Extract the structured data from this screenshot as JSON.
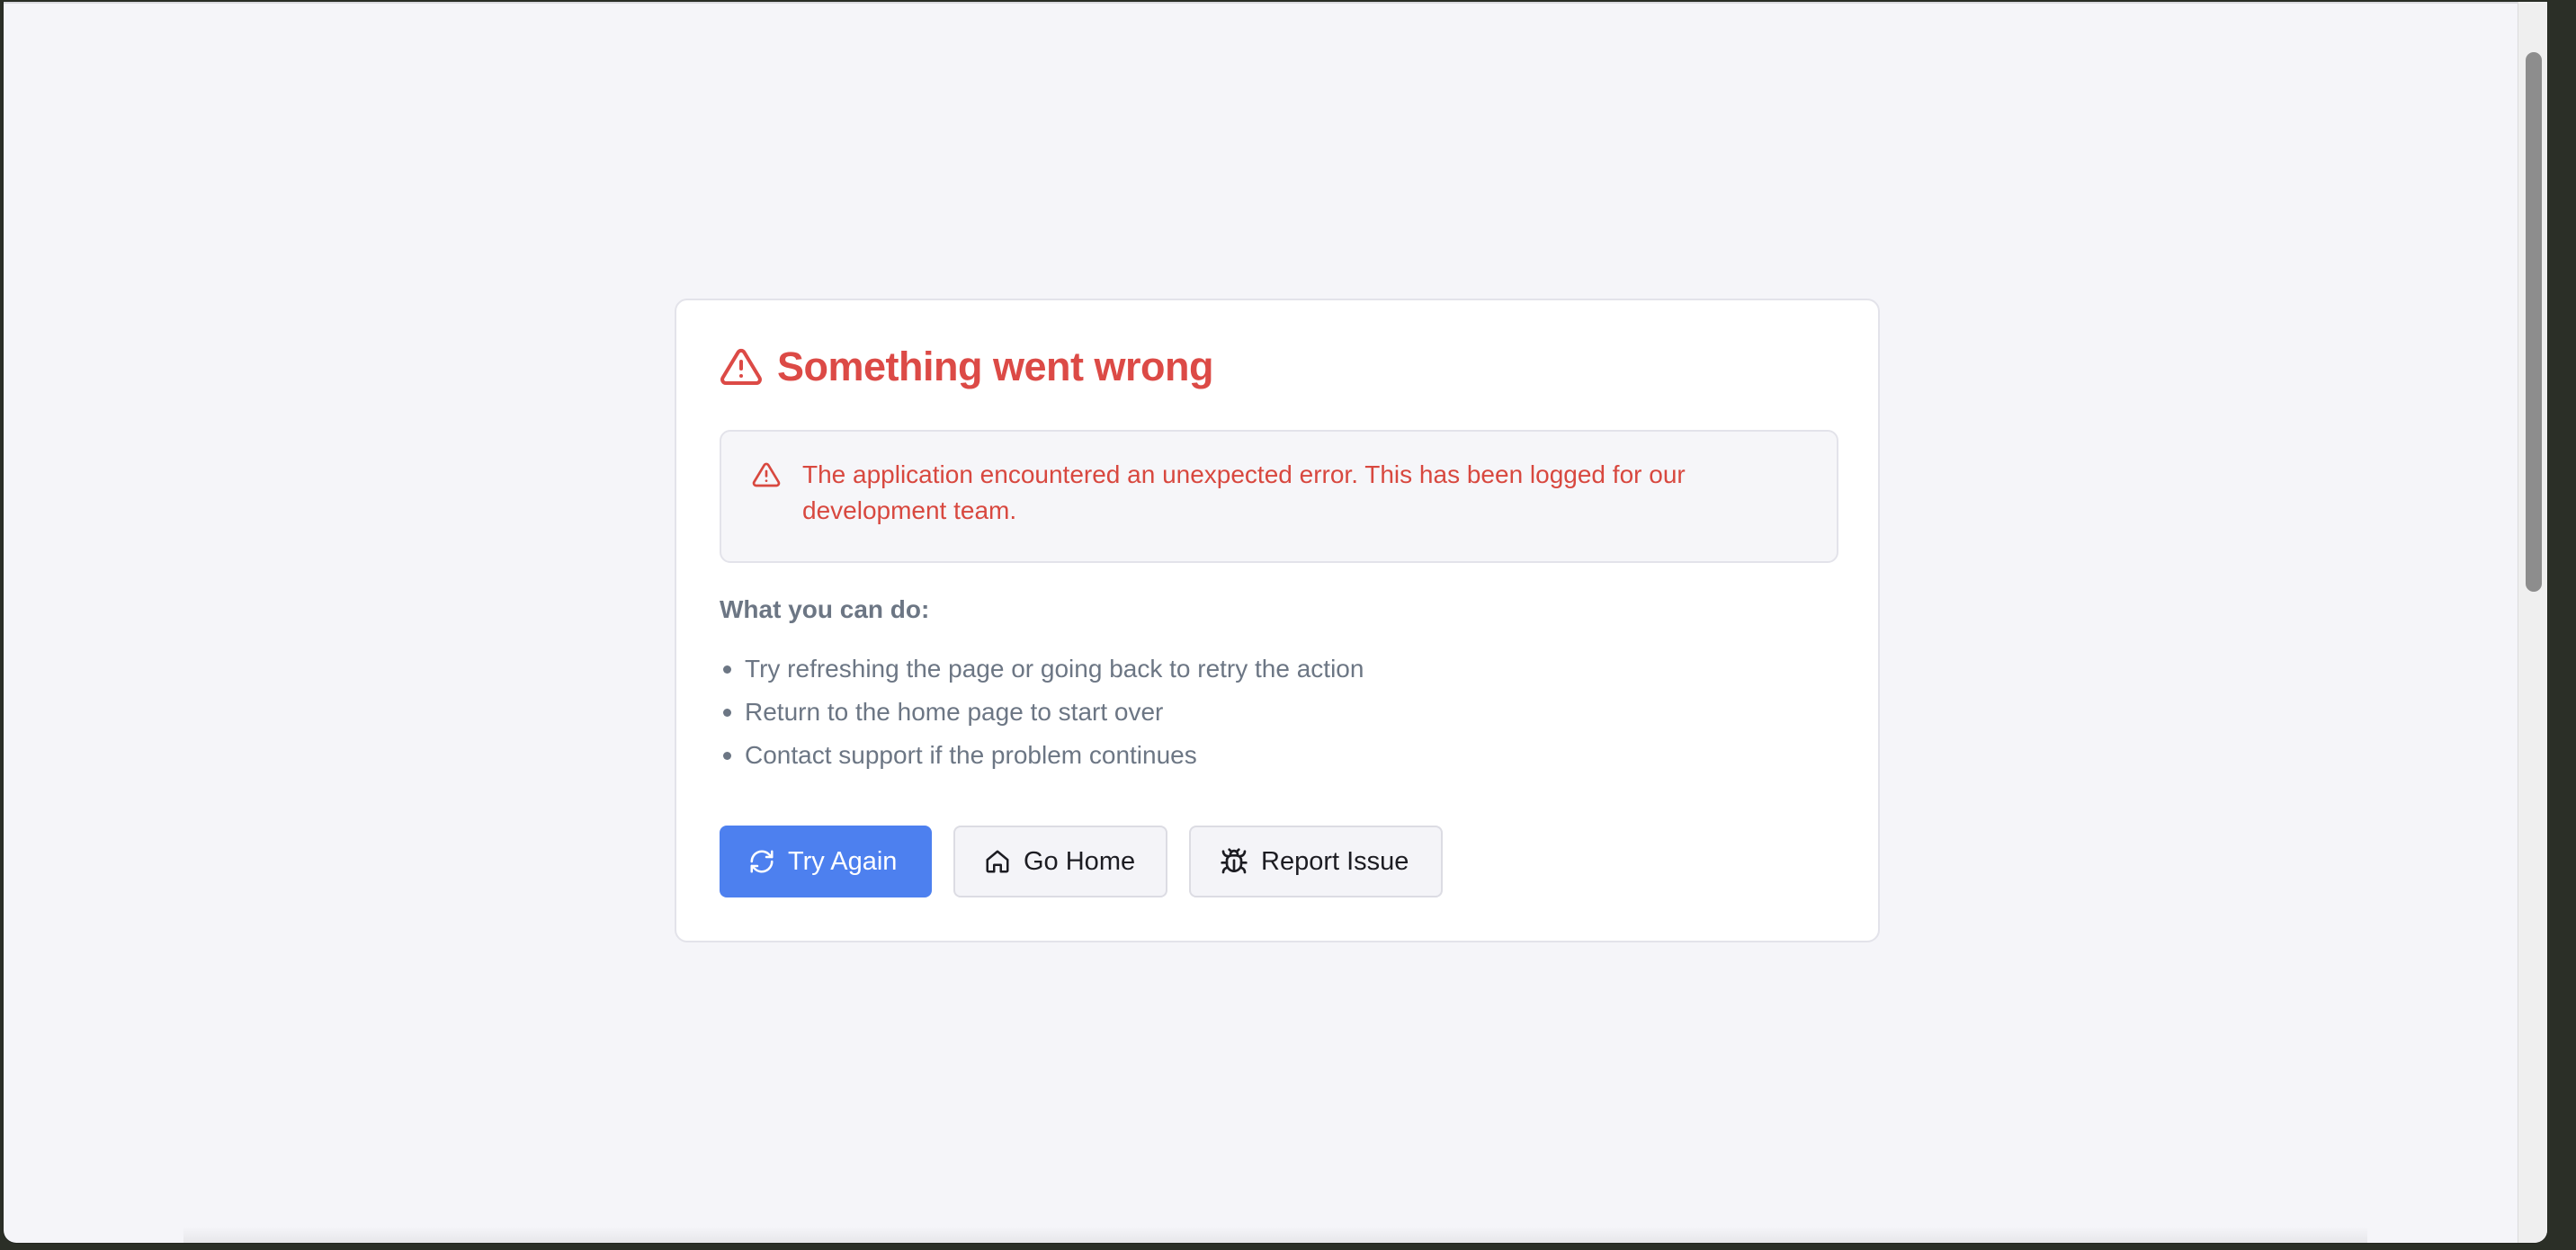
{
  "error": {
    "title": "Something went wrong",
    "message": "The application encountered an unexpected error. This has been logged for our development team."
  },
  "help": {
    "heading": "What you can do:",
    "items": [
      "Try refreshing the page or going back to retry the action",
      "Return to the home page to start over",
      "Contact support if the problem continues"
    ]
  },
  "actions": {
    "try_again": "Try Again",
    "go_home": "Go Home",
    "report_issue": "Report Issue"
  },
  "icons": {
    "title": "alert-triangle-icon",
    "alert": "alert-triangle-icon",
    "try_again": "refresh-icon",
    "go_home": "home-icon",
    "report_issue": "bug-icon"
  },
  "colors": {
    "error": "#dc4a46",
    "primary": "#4d80ef",
    "muted_text": "#6c7684",
    "background": "#f5f5f9"
  }
}
